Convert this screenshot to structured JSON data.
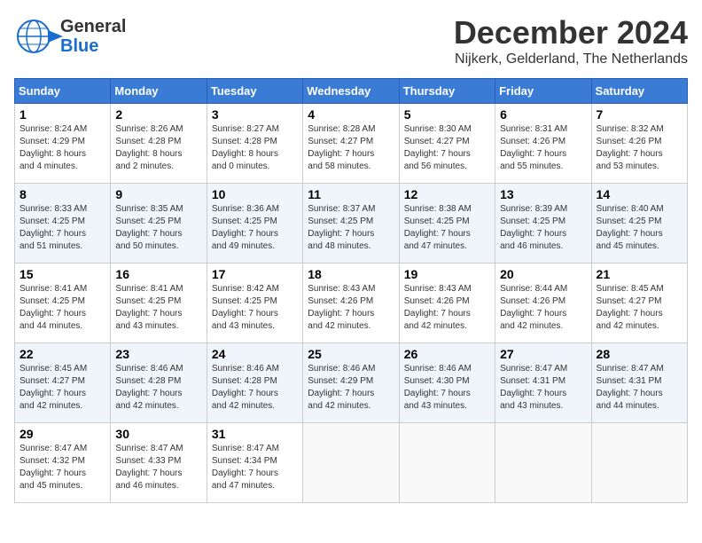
{
  "header": {
    "logo_general": "General",
    "logo_blue": "Blue",
    "month_title": "December 2024",
    "location": "Nijkerk, Gelderland, The Netherlands"
  },
  "calendar": {
    "days_of_week": [
      "Sunday",
      "Monday",
      "Tuesday",
      "Wednesday",
      "Thursday",
      "Friday",
      "Saturday"
    ],
    "weeks": [
      [
        {
          "day": "1",
          "info": "Sunrise: 8:24 AM\nSunset: 4:29 PM\nDaylight: 8 hours\nand 4 minutes."
        },
        {
          "day": "2",
          "info": "Sunrise: 8:26 AM\nSunset: 4:28 PM\nDaylight: 8 hours\nand 2 minutes."
        },
        {
          "day": "3",
          "info": "Sunrise: 8:27 AM\nSunset: 4:28 PM\nDaylight: 8 hours\nand 0 minutes."
        },
        {
          "day": "4",
          "info": "Sunrise: 8:28 AM\nSunset: 4:27 PM\nDaylight: 7 hours\nand 58 minutes."
        },
        {
          "day": "5",
          "info": "Sunrise: 8:30 AM\nSunset: 4:27 PM\nDaylight: 7 hours\nand 56 minutes."
        },
        {
          "day": "6",
          "info": "Sunrise: 8:31 AM\nSunset: 4:26 PM\nDaylight: 7 hours\nand 55 minutes."
        },
        {
          "day": "7",
          "info": "Sunrise: 8:32 AM\nSunset: 4:26 PM\nDaylight: 7 hours\nand 53 minutes."
        }
      ],
      [
        {
          "day": "8",
          "info": "Sunrise: 8:33 AM\nSunset: 4:25 PM\nDaylight: 7 hours\nand 51 minutes."
        },
        {
          "day": "9",
          "info": "Sunrise: 8:35 AM\nSunset: 4:25 PM\nDaylight: 7 hours\nand 50 minutes."
        },
        {
          "day": "10",
          "info": "Sunrise: 8:36 AM\nSunset: 4:25 PM\nDaylight: 7 hours\nand 49 minutes."
        },
        {
          "day": "11",
          "info": "Sunrise: 8:37 AM\nSunset: 4:25 PM\nDaylight: 7 hours\nand 48 minutes."
        },
        {
          "day": "12",
          "info": "Sunrise: 8:38 AM\nSunset: 4:25 PM\nDaylight: 7 hours\nand 47 minutes."
        },
        {
          "day": "13",
          "info": "Sunrise: 8:39 AM\nSunset: 4:25 PM\nDaylight: 7 hours\nand 46 minutes."
        },
        {
          "day": "14",
          "info": "Sunrise: 8:40 AM\nSunset: 4:25 PM\nDaylight: 7 hours\nand 45 minutes."
        }
      ],
      [
        {
          "day": "15",
          "info": "Sunrise: 8:41 AM\nSunset: 4:25 PM\nDaylight: 7 hours\nand 44 minutes."
        },
        {
          "day": "16",
          "info": "Sunrise: 8:41 AM\nSunset: 4:25 PM\nDaylight: 7 hours\nand 43 minutes."
        },
        {
          "day": "17",
          "info": "Sunrise: 8:42 AM\nSunset: 4:25 PM\nDaylight: 7 hours\nand 43 minutes."
        },
        {
          "day": "18",
          "info": "Sunrise: 8:43 AM\nSunset: 4:26 PM\nDaylight: 7 hours\nand 42 minutes."
        },
        {
          "day": "19",
          "info": "Sunrise: 8:43 AM\nSunset: 4:26 PM\nDaylight: 7 hours\nand 42 minutes."
        },
        {
          "day": "20",
          "info": "Sunrise: 8:44 AM\nSunset: 4:26 PM\nDaylight: 7 hours\nand 42 minutes."
        },
        {
          "day": "21",
          "info": "Sunrise: 8:45 AM\nSunset: 4:27 PM\nDaylight: 7 hours\nand 42 minutes."
        }
      ],
      [
        {
          "day": "22",
          "info": "Sunrise: 8:45 AM\nSunset: 4:27 PM\nDaylight: 7 hours\nand 42 minutes."
        },
        {
          "day": "23",
          "info": "Sunrise: 8:46 AM\nSunset: 4:28 PM\nDaylight: 7 hours\nand 42 minutes."
        },
        {
          "day": "24",
          "info": "Sunrise: 8:46 AM\nSunset: 4:28 PM\nDaylight: 7 hours\nand 42 minutes."
        },
        {
          "day": "25",
          "info": "Sunrise: 8:46 AM\nSunset: 4:29 PM\nDaylight: 7 hours\nand 42 minutes."
        },
        {
          "day": "26",
          "info": "Sunrise: 8:46 AM\nSunset: 4:30 PM\nDaylight: 7 hours\nand 43 minutes."
        },
        {
          "day": "27",
          "info": "Sunrise: 8:47 AM\nSunset: 4:31 PM\nDaylight: 7 hours\nand 43 minutes."
        },
        {
          "day": "28",
          "info": "Sunrise: 8:47 AM\nSunset: 4:31 PM\nDaylight: 7 hours\nand 44 minutes."
        }
      ],
      [
        {
          "day": "29",
          "info": "Sunrise: 8:47 AM\nSunset: 4:32 PM\nDaylight: 7 hours\nand 45 minutes."
        },
        {
          "day": "30",
          "info": "Sunrise: 8:47 AM\nSunset: 4:33 PM\nDaylight: 7 hours\nand 46 minutes."
        },
        {
          "day": "31",
          "info": "Sunrise: 8:47 AM\nSunset: 4:34 PM\nDaylight: 7 hours\nand 47 minutes."
        },
        {
          "day": "",
          "info": ""
        },
        {
          "day": "",
          "info": ""
        },
        {
          "day": "",
          "info": ""
        },
        {
          "day": "",
          "info": ""
        }
      ]
    ]
  }
}
